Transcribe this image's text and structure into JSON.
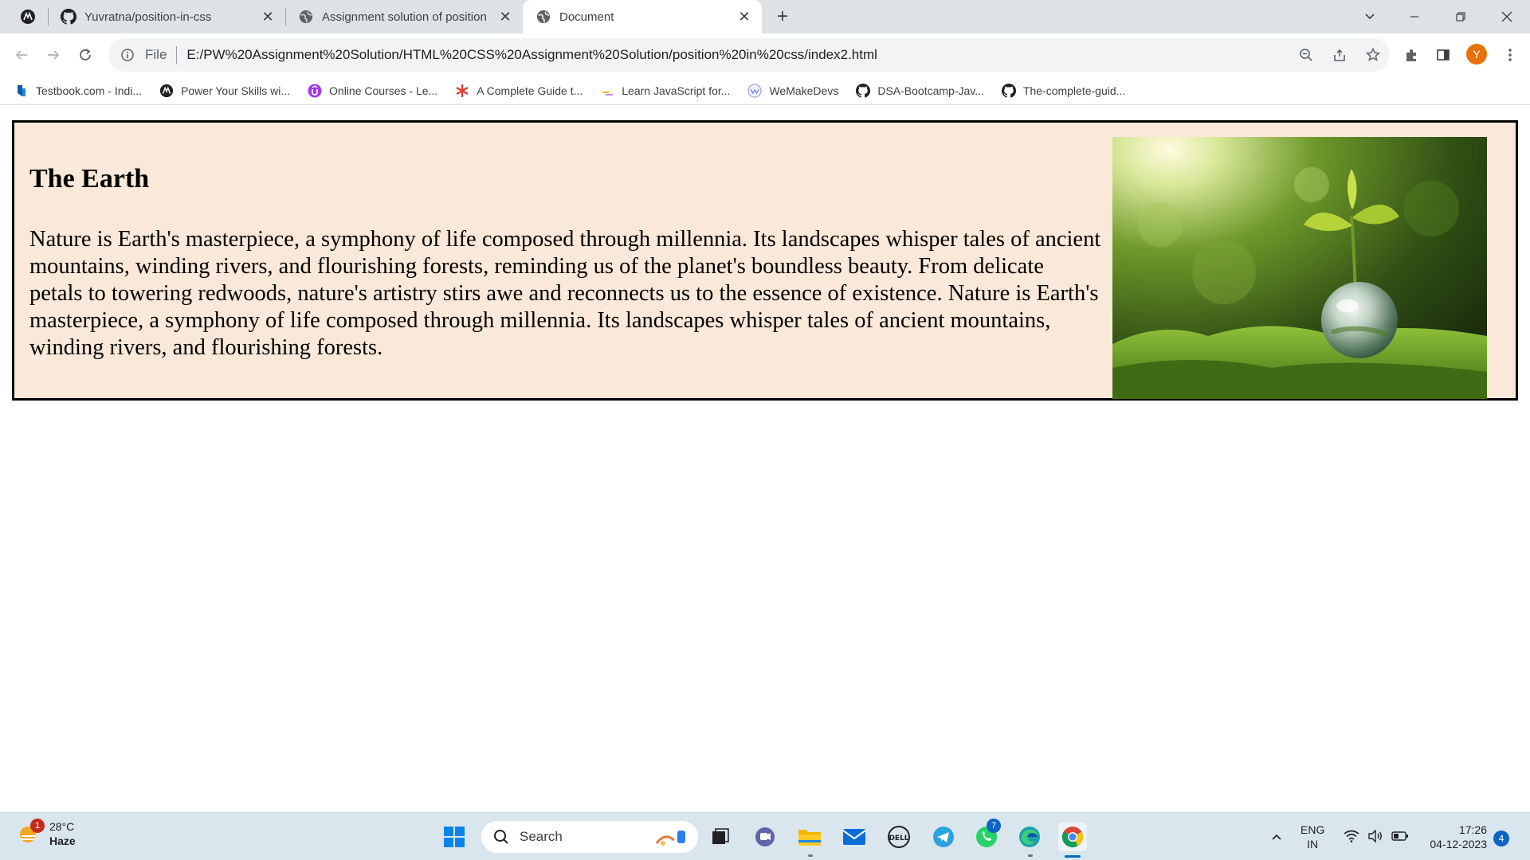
{
  "browser": {
    "tabs": [
      {
        "title": "Yuvratna/position-in-css",
        "favicon": "github-icon"
      },
      {
        "title": "Assignment solution of position",
        "favicon": "globe-icon"
      },
      {
        "title": "Document",
        "favicon": "globe-icon",
        "active": true
      }
    ],
    "address": {
      "scheme_label": "File",
      "url": "E:/PW%20Assignment%20Solution/HTML%20CSS%20Assignment%20Solution/position%20in%20css/index2.html"
    },
    "profile_initial": "Y",
    "profile_color": "#e8710a"
  },
  "bookmarks": [
    {
      "label": "Testbook.com - Indi...",
      "icon": "testbook-icon"
    },
    {
      "label": "Power Your Skills wi...",
      "icon": "pw-icon"
    },
    {
      "label": "Online Courses - Le...",
      "icon": "udemy-icon"
    },
    {
      "label": "A Complete Guide t...",
      "icon": "asterisk-icon"
    },
    {
      "label": "Learn JavaScript for...",
      "icon": "js-icon"
    },
    {
      "label": "WeMakeDevs",
      "icon": "wemakedevs-icon"
    },
    {
      "label": "DSA-Bootcamp-Jav...",
      "icon": "github-icon"
    },
    {
      "label": "The-complete-guid...",
      "icon": "github-icon"
    }
  ],
  "page": {
    "heading": "The Earth",
    "paragraph": "Nature is Earth's masterpiece, a symphony of life composed through millennia. Its landscapes whisper tales of ancient mountains, winding rivers, and flourishing forests, reminding us of the planet's boundless beauty. From delicate petals to towering redwoods, nature's artistry stirs awe and reconnects us to the essence of existence. Nature is Earth's masterpiece, a symphony of life composed through millennia. Its landscapes whisper tales of ancient mountains, winding rivers, and flourishing forests.",
    "card_background": "#fae8d8",
    "image": "plant-in-glass-globe-on-moss"
  },
  "taskbar": {
    "weather": {
      "temp": "28°C",
      "condition": "Haze",
      "badge": "1"
    },
    "search_placeholder": "Search",
    "apps": [
      "windows-start-icon",
      "task-view-icon",
      "teams-chat-icon",
      "file-explorer-icon",
      "mail-icon",
      "dell-icon",
      "telegram-icon",
      "whatsapp-icon",
      "edge-icon",
      "chrome-icon"
    ],
    "whatsapp_badge": "7",
    "language": {
      "line1": "ENG",
      "line2": "IN"
    },
    "clock": {
      "time": "17:26",
      "date": "04-12-2023"
    },
    "notifications": "4"
  }
}
